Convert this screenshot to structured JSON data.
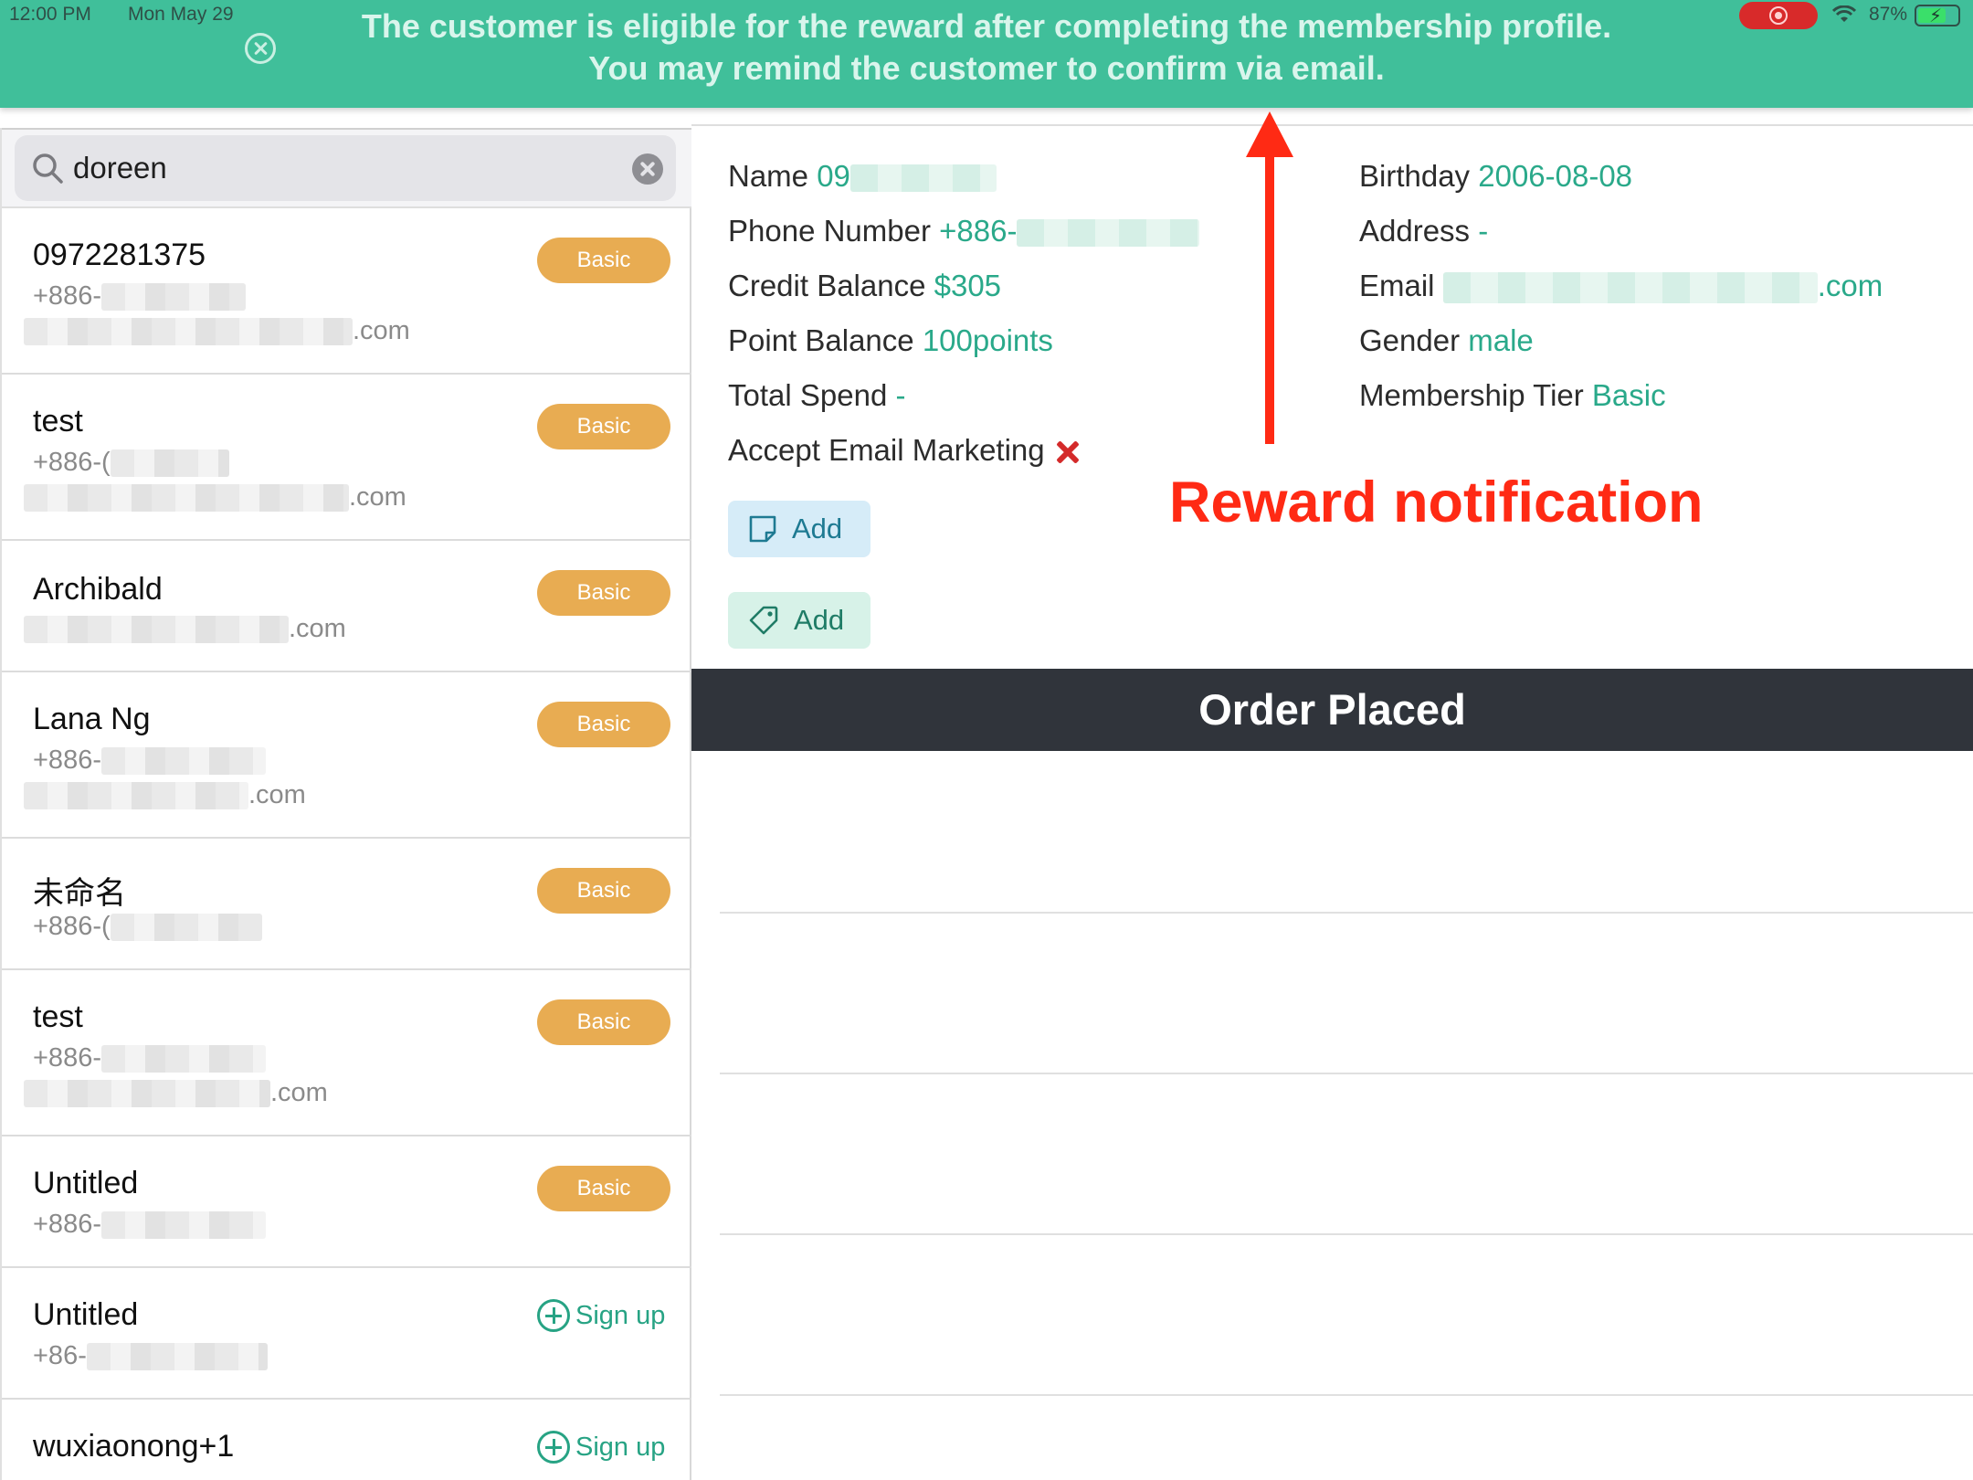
{
  "status_bar": {
    "time": "12:00 PM",
    "date": "Mon May 29",
    "battery": "87%"
  },
  "banner": {
    "line1": "The customer is eligible for the reward after completing the membership profile.",
    "line2": "You may remind the customer to confirm via email."
  },
  "search": {
    "value": "doreen",
    "placeholder": "Search"
  },
  "customers": [
    {
      "name": "0972281375",
      "phone": "+886-",
      "email_suffix": ".com",
      "action": "Basic"
    },
    {
      "name": "test",
      "phone": "+886-(",
      "email_suffix": ".com",
      "action": "Basic"
    },
    {
      "name": "Archibald",
      "phone": "",
      "email_suffix": ".com",
      "action": "Basic"
    },
    {
      "name": "Lana Ng",
      "phone": "+886-",
      "email_suffix": ".com",
      "action": "Basic"
    },
    {
      "name": "未命名",
      "phone": "+886-(",
      "email_suffix": "",
      "action": "Basic"
    },
    {
      "name": "test",
      "phone": "+886-",
      "email_suffix": ".com",
      "action": "Basic"
    },
    {
      "name": "Untitled",
      "phone": "+886-",
      "email_suffix": "",
      "action": "Basic"
    },
    {
      "name": "Untitled",
      "phone": "+86-",
      "email_suffix": "",
      "action": "Sign up"
    },
    {
      "name": "wuxiaonong+1",
      "phone": "",
      "email_suffix": "",
      "action": "Sign up"
    }
  ],
  "profile": {
    "name_label": "Name",
    "name_value": "09",
    "phone_label": "Phone Number",
    "phone_value": "+886-",
    "credit_label": "Credit Balance",
    "credit_value": "$305",
    "point_label": "Point Balance",
    "point_value": "100points",
    "spend_label": "Total Spend",
    "spend_value": "-",
    "email_marketing_label": "Accept Email Marketing",
    "birthday_label": "Birthday",
    "birthday_value": "2006-08-08",
    "address_label": "Address",
    "address_value": "-",
    "email_label": "Email",
    "email_value": ".com",
    "gender_label": "Gender",
    "gender_value": "male",
    "tier_label": "Membership Tier",
    "tier_value": "Basic"
  },
  "actions": {
    "add_note": "Add",
    "add_tag": "Add"
  },
  "orders": {
    "section_title": "Order Placed"
  },
  "annotation": {
    "label": "Reward notification"
  },
  "colors": {
    "banner": "#40bf9a",
    "accent": "#2aa98a",
    "badge": "#e8ac52",
    "section_bar": "#30343b",
    "annotation": "#ff2a14"
  }
}
